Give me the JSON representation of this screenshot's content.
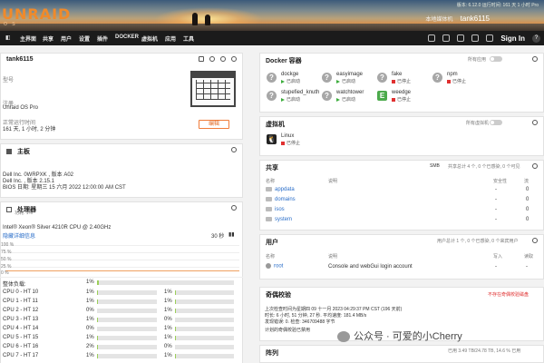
{
  "banner": {
    "brand": "UNRAID",
    "brand_sub": "O S",
    "server_name": "tank6115",
    "server_desc": "本地媒体机",
    "version_line": "版本: 6.12.0  运行时间: 161 天 1 小时  Pro"
  },
  "nav": {
    "items": [
      "主界面",
      "共享",
      "用户",
      "设置",
      "插件",
      "DOCKER",
      "虚拟机",
      "应用",
      "工具"
    ],
    "signin": "Sign In"
  },
  "server_panel": {
    "title": "tank6115",
    "model_label": "型号",
    "registration_label": "注册",
    "registration_value": "Unraid OS Pro",
    "uptime_label": "正常运行时间",
    "uptime_value": "161 天, 1 小时, 2 分钟",
    "edit_button": "编辑"
  },
  "mainboard_panel": {
    "title": "主板",
    "line1": "Dell Inc. 0WRPXK , 版本 A02",
    "line2": "Dell Inc. , 版本 2.15.1",
    "line3": "BIOS 日期: 星期三 15 六月 2022 12:00:00 AM CST"
  },
  "processor_panel": {
    "title": "处理器",
    "power_label": "功耗: 1%",
    "cpu_model": "Intel® Xeon® Silver 4210R CPU @ 2.40GHz",
    "show_link": "隐藏详细信息",
    "interval": "30 秒",
    "graph_ticks": [
      "100 %",
      "75 %",
      "50 %",
      "25 %",
      "0 %"
    ],
    "overall_label": "整体负载:",
    "overall_value": "1%",
    "cores": [
      {
        "a_label": "CPU 0 - HT 10",
        "a_value": "1%",
        "b_value": "1%"
      },
      {
        "a_label": "CPU 1 - HT 11",
        "a_value": "1%",
        "b_value": "1%"
      },
      {
        "a_label": "CPU 2 - HT 12",
        "a_value": "0%",
        "b_value": "1%"
      },
      {
        "a_label": "CPU 3 - HT 13",
        "a_value": "1%",
        "b_value": "0%"
      },
      {
        "a_label": "CPU 4 - HT 14",
        "a_value": "0%",
        "b_value": "1%"
      },
      {
        "a_label": "CPU 5 - HT 15",
        "a_value": "1%",
        "b_value": "1%"
      },
      {
        "a_label": "CPU 6 - HT 16",
        "a_value": "2%",
        "b_value": "0%"
      },
      {
        "a_label": "CPU 7 - HT 17",
        "a_value": "1%",
        "b_value": "1%"
      }
    ]
  },
  "docker_panel": {
    "title": "Docker 容器",
    "toggle_label": "所有应用",
    "containers": [
      {
        "name": "dockge",
        "state": "已启动",
        "running": true,
        "icon": "?"
      },
      {
        "name": "easyimage",
        "state": "已启动",
        "running": true,
        "icon": "?"
      },
      {
        "name": "fake",
        "state": "已停止",
        "running": false,
        "icon": "?"
      },
      {
        "name": "npm",
        "state": "已停止",
        "running": false,
        "icon": "?"
      },
      {
        "name": "stupefied_knuth",
        "state": "已启动",
        "running": true,
        "icon": "?"
      },
      {
        "name": "watchtower",
        "state": "已启动",
        "running": true,
        "icon": "?"
      },
      {
        "name": "weedge",
        "state": "已停止",
        "running": false,
        "icon": "E"
      }
    ]
  },
  "vm_panel": {
    "title": "虚拟机",
    "toggle_label": "所有虚拟机",
    "vms": [
      {
        "name": "Linux",
        "state": "已停止"
      }
    ]
  },
  "shares_panel": {
    "title": "共享",
    "filter": "SMB",
    "summary": "共享总计 4 个, 0 个已感染, 0 个可见",
    "columns": [
      "名称",
      "说明",
      "安全性",
      "流"
    ],
    "rows": [
      {
        "name": "appdata",
        "desc": "",
        "security": "-",
        "streams": "0"
      },
      {
        "name": "domains",
        "desc": "",
        "security": "-",
        "streams": "0"
      },
      {
        "name": "isos",
        "desc": "",
        "security": "-",
        "streams": "0"
      },
      {
        "name": "system",
        "desc": "",
        "security": "-",
        "streams": "0"
      }
    ]
  },
  "users_panel": {
    "title": "用户",
    "summary": "用户总计 1 个, 0 个已感染, 0 个来宾用户",
    "columns": [
      "名称",
      "说明",
      "写入",
      "读取"
    ],
    "rows": [
      {
        "name": "root",
        "desc": "Console and webGui login account",
        "write": "-",
        "read": "-"
      }
    ]
  },
  "parity_panel": {
    "title": "奇偶校验",
    "status": "不存在奇偶校验磁盘",
    "line1": "上次检查时间为星期四 09 十一月 2023 04:29:37 PM CST (196 天前)",
    "line2": "时长: 6 小时, 51 分钟, 27 秒. 平均速度: 181.4 MB/s",
    "line3": "发现错误: 0. 检查: 346709488 字节",
    "line4": "计划的奇偶校验已禁用"
  },
  "array_panel": {
    "title": "阵列",
    "summary": "已用 3.49 TB/24.78 TB, 14.6 % 已用"
  },
  "watermark": {
    "text": "公众号 · 可爱的小Cherry"
  }
}
